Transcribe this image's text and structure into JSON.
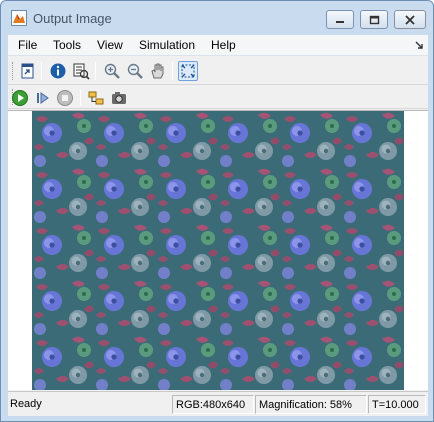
{
  "window": {
    "title": "Output Image",
    "icon": "matlab-figure-icon",
    "controls": [
      "minimize-icon",
      "maximize-icon",
      "close-icon"
    ]
  },
  "menubar": {
    "items": [
      {
        "label": "File"
      },
      {
        "label": "Tools"
      },
      {
        "label": "View"
      },
      {
        "label": "Simulation"
      },
      {
        "label": "Help"
      }
    ]
  },
  "toolbar1": {
    "buttons": [
      "open-window-icon",
      "info-icon",
      "pixel-region-icon",
      "zoom-in-icon",
      "zoom-out-icon",
      "pan-icon",
      "fit-to-view-icon"
    ],
    "active": "fit-to-view-icon"
  },
  "toolbar2": {
    "buttons": [
      "run-icon",
      "step-forward-icon",
      "stop-icon",
      "highlight-block-icon",
      "snapshot-icon"
    ]
  },
  "status": {
    "ready": "Ready",
    "rgb": "RGB:480x640",
    "magnification": "Magnification: 58%",
    "time": "T=10.000"
  },
  "image": {
    "description_colors": {
      "background": "#3b6b76",
      "leaf": "#9a4f6e",
      "flower_blue": "#6c78e0",
      "flower_gray": "#7f9aa6",
      "flower_green": "#5fa37e"
    }
  },
  "colors": {
    "window_frame": "#c9dbee",
    "active_button": "#dcebfb",
    "run_green": "#3aa034"
  }
}
